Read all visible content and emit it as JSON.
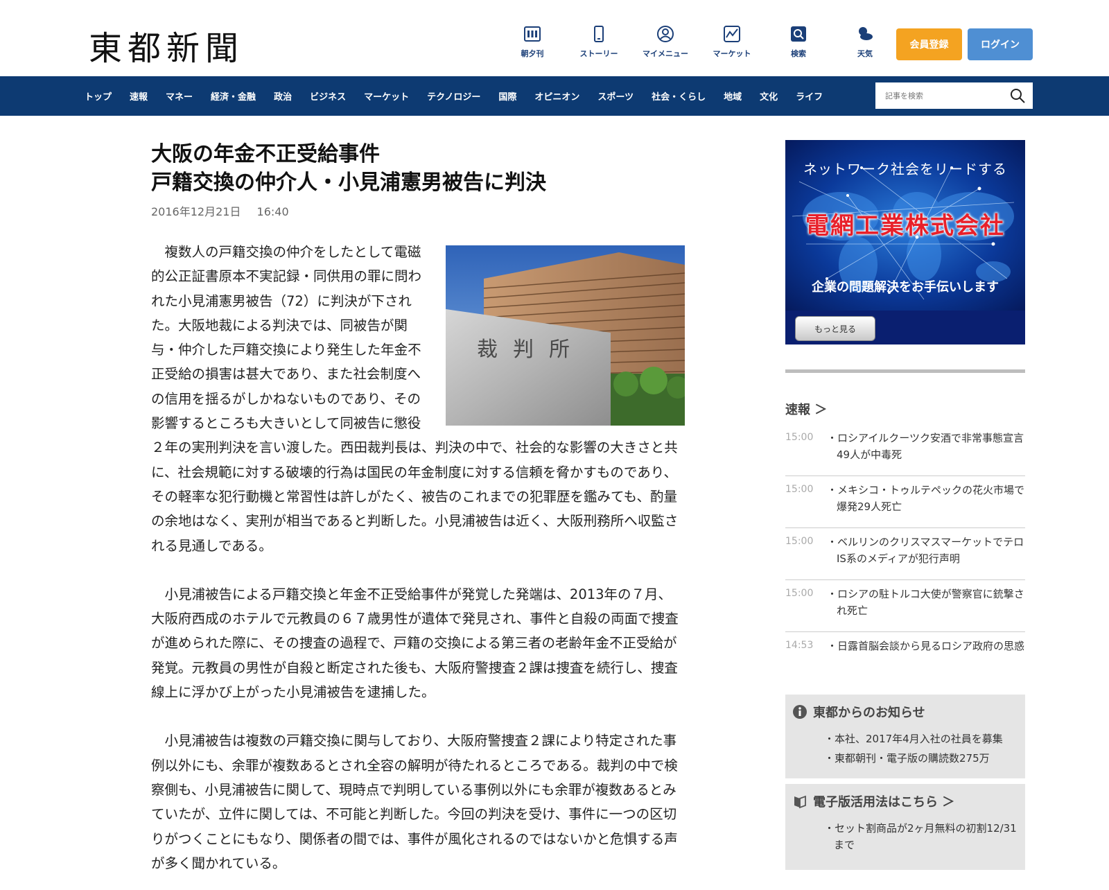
{
  "header": {
    "logo": "東都新聞",
    "nav": [
      {
        "label": "朝夕刊",
        "icon": "newspaper-icon"
      },
      {
        "label": "ストーリー",
        "icon": "phone-icon"
      },
      {
        "label": "マイメニュー",
        "icon": "user-icon"
      },
      {
        "label": "マーケット",
        "icon": "chart-icon"
      },
      {
        "label": "検索",
        "icon": "search-icon"
      },
      {
        "label": "天気",
        "icon": "weather-icon"
      }
    ],
    "register_label": "会員登録",
    "login_label": "ログイン",
    "accent_orange": "#f4a321",
    "accent_blue": "#4f8fd3"
  },
  "categories": [
    "トップ",
    "速報",
    "マネー",
    "経済・金融",
    "政治",
    "ビジネス",
    "マーケット",
    "テクノロジー",
    "国際",
    "オピニオン",
    "スポーツ",
    "社会・くらし",
    "地域",
    "文化",
    "ライフ"
  ],
  "search": {
    "placeholder": "記事を検索"
  },
  "article": {
    "title_line1": "大阪の年金不正受給事件",
    "title_line2": "戸籍交換の仲介人・小見浦憲男被告に判決",
    "date": "2016年12月21日",
    "time": "16:40",
    "photo_sign": "裁判所",
    "paragraphs": [
      "複数人の戸籍交換の仲介をしたとして電磁的公正証書原本不実記録・同供用の罪に問われた小見浦憲男被告（72）に判決が下された。大阪地裁による判決では、同被告が関与・仲介した戸籍交換により発生した年金不正受給の損害は甚大であり、また社会制度への信用を揺るがしかねないものであり、その影響するところも大きいとして同被告に懲役２年の実刑判決を言い渡した。西田裁判長は、判決の中で、社会的な影響の大きさと共に、社会規範に対する破壊的行為は国民の年金制度に対する信頼を脅かすものであり、その軽率な犯行動機と常習性は許しがたく、被告のこれまでの犯罪歴を鑑みても、酌量の余地はなく、実刑が相当であると判断した。小見浦被告は近く、大阪刑務所へ収監される見通しである。",
      "小見浦被告による戸籍交換と年金不正受給事件が発覚した発端は、2013年の７月、大阪府西成のホテルで元教員の６７歳男性が遺体で発見され、事件と自殺の両面で捜査が進められた際に、その捜査の過程で、戸籍の交換による第三者の老齢年金不正受給が発覚。元教員の男性が自殺と断定された後も、大阪府警捜査２課は捜査を続行し、捜査線上に浮かび上がった小見浦被告を逮捕した。",
      "小見浦被告は複数の戸籍交換に関与しており、大阪府警捜査２課により特定された事例以外にも、余罪が複数あるとされ全容の解明が待たれるところである。裁判の中で検察側も、小見浦被告に関して、現時点で判明している事例以外にも余罪が複数あるとみていたが、立件に関しては、不可能と判断した。今回の判決を受け、事件に一つの区切りがつくことにもなり、関係者の間では、事件が風化されるのではないかと危惧する声が多く聞かれている。"
    ]
  },
  "ad": {
    "line1": "ネットワーク社会をリードする",
    "company": "電網工業株式会社",
    "line3": "企業の問題解決をお手伝いします",
    "more_label": "もっと見る"
  },
  "sokuho": {
    "heading": "速報 ＞",
    "items": [
      {
        "time": "15:00",
        "text": "・ロシアイルクーツク安酒で非常事態宣言49人が中毒死"
      },
      {
        "time": "15:00",
        "text": "・メキシコ・トゥルテペックの花火市場で爆発29人死亡"
      },
      {
        "time": "15:00",
        "text": "・ベルリンのクリスマスマーケットでテロIS系のメディアが犯行声明"
      },
      {
        "time": "15:00",
        "text": "・ロシアの駐トルコ大使が警察官に銃撃され死亡"
      },
      {
        "time": "14:53",
        "text": "・日露首脳会談から見るロシア政府の思惑"
      }
    ]
  },
  "notice": {
    "heading": "東都からのお知らせ",
    "items": [
      "・本社、2017年4月入社の社員を募集",
      "・東都朝刊・電子版の購読数275万"
    ]
  },
  "digital": {
    "heading": "電子版活用法はこちら ＞",
    "items": [
      "・セット割商品が2ヶ月無料の初割12/31まで"
    ]
  }
}
